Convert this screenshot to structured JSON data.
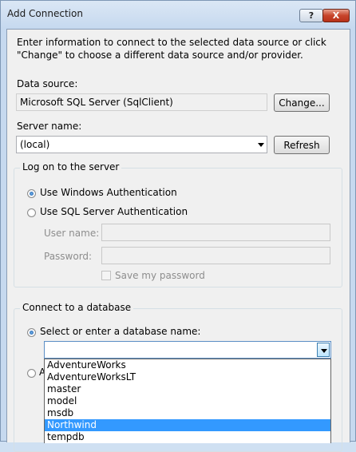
{
  "window": {
    "title": "Add Connection",
    "help_glyph": "?",
    "close_glyph": "X"
  },
  "instructions": "Enter information to connect to the selected data source or click \"Change\" to choose a different data source and/or provider.",
  "data_source": {
    "label": "Data source:",
    "value": "Microsoft SQL Server (SqlClient)",
    "change_label": "Change..."
  },
  "server": {
    "label": "Server name:",
    "value": "(local)",
    "refresh_label": "Refresh"
  },
  "logon": {
    "title": "Log on to the server",
    "windows_auth": "Use Windows Authentication",
    "sql_auth": "Use SQL Server Authentication",
    "user_label": "User name:",
    "password_label": "Password:",
    "save_password": "Save my password",
    "selected": "windows"
  },
  "database": {
    "title": "Connect to a database",
    "select_option": "Select or enter a database name:",
    "attach_partial": "A",
    "value": "",
    "options": [
      "AdventureWorks",
      "AdventureWorksLT",
      "master",
      "model",
      "msdb",
      "Northwind",
      "tempdb"
    ],
    "highlighted": "Northwind"
  },
  "colors": {
    "selection": "#3399ff",
    "window_frame": "#c6d9ef",
    "client_bg": "#f0f0f0"
  }
}
